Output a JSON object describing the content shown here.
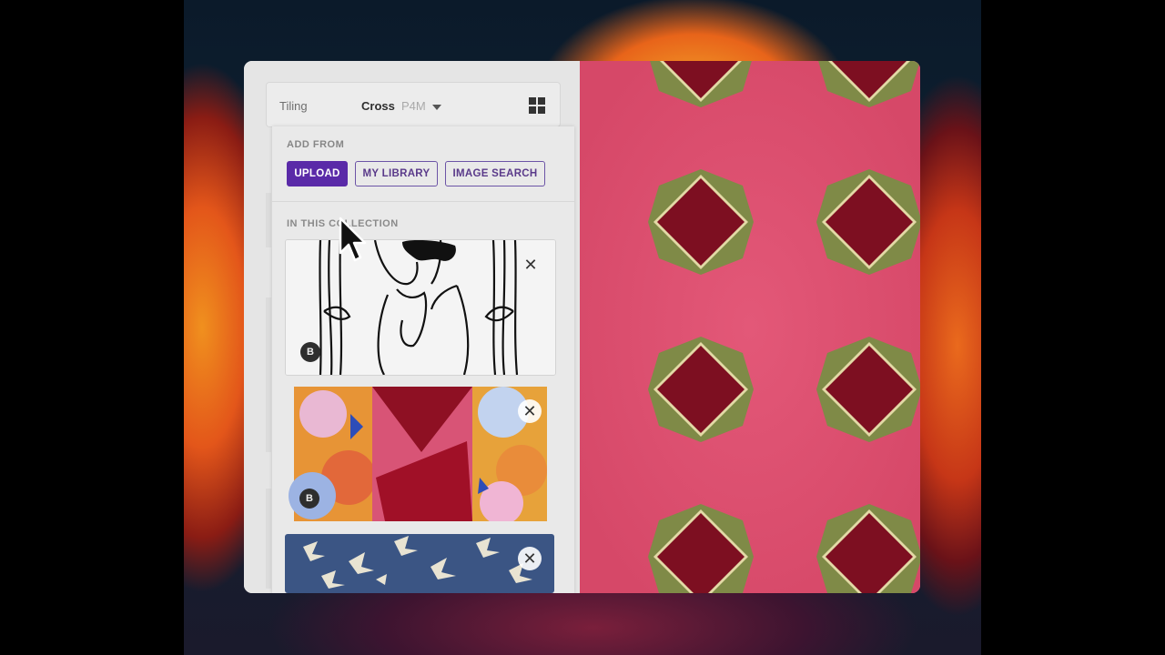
{
  "window": {
    "tiling": {
      "label": "Tiling",
      "value": "Cross",
      "subvalue": "P4M",
      "grid_icon": "grid-icon",
      "dropdown_icon": "caret-down-icon"
    },
    "popup": {
      "add_from_heading": "ADD FROM",
      "buttons": {
        "upload": "UPLOAD",
        "library": "MY LIBRARY",
        "search": "IMAGE SEARCH"
      },
      "collection_heading": "IN THIS COLLECTION",
      "items": [
        {
          "badge": "B",
          "close": "✕",
          "kind": "line-drawing"
        },
        {
          "badge": "B",
          "close": "✕",
          "kind": "geometric-collage"
        },
        {
          "badge": "",
          "close": "✕",
          "kind": "bird-pattern"
        }
      ]
    }
  },
  "colors": {
    "accent": "#5a2aa8",
    "preview_background": "#dc4d6c",
    "tile_diamond": "#7d0f21",
    "tile_frame": "#7f8a47"
  },
  "icons": [
    "caret-down-icon",
    "grid-icon",
    "close-icon",
    "mouse-cursor-icon"
  ]
}
